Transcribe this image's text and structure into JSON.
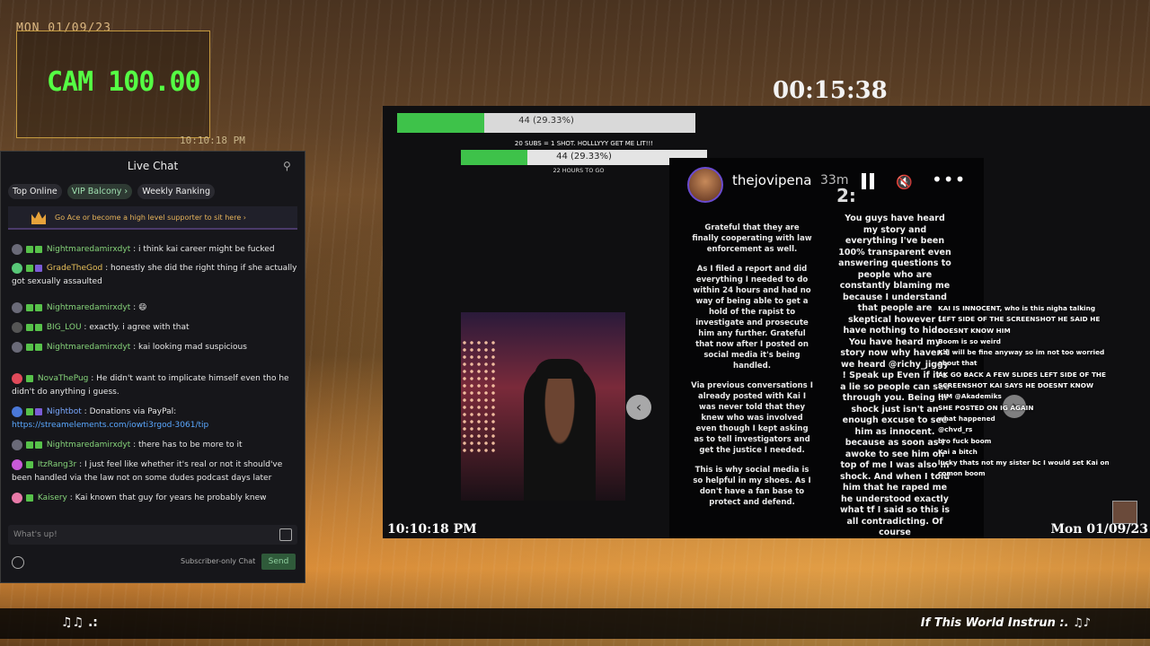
{
  "overlay": {
    "date_top": "MON 01/09/23",
    "cam_label": "CAM 100.00",
    "cam_time": "10:10:18 PM",
    "timer": "00:15:38",
    "time_left": "10:10:18 PM",
    "date_right": "Mon 01/09/23",
    "notes_left": "♫♫ .:",
    "song": "If This World Instrun :. ♫♪"
  },
  "chat": {
    "title": "Live Chat",
    "tabs": [
      "Top Online",
      "VIP Balcony ›",
      "Weekly Ranking"
    ],
    "promo": "Go Ace or become a high level supporter to sit here ›",
    "input_placeholder": "What's up!",
    "subscriber_only": "Subscriber-only Chat",
    "send": "Send",
    "messages": [
      {
        "user": "Nightmaredamirxdyt",
        "text": "i think kai career might be fucked"
      },
      {
        "user": "GradeTheGod",
        "text": "honestly she did the right thing if she actually got sexually assaulted"
      },
      {
        "user": "Nightmaredamirxdyt",
        "text": "😄"
      },
      {
        "user": "BIG_LOU",
        "text": "exactly. i agree with that"
      },
      {
        "user": "Nightmaredamirxdyt",
        "text": "kai looking mad suspicious"
      },
      {
        "user": "NovaThePug",
        "text": "He didn't want to implicate himself even tho he didn't do anything i guess."
      },
      {
        "user": "Nightbot",
        "text": "Donations via PayPal:",
        "link": "https://streamelements.com/iowti3rgod-3061/tip"
      },
      {
        "user": "Nightmaredamirxdyt",
        "text": "there has to be more to it"
      },
      {
        "user": "ItzRang3r",
        "text": "I just feel like whether it's real or not it should've been handled via the law not on some dudes podcast days later"
      },
      {
        "user": "Kaisery",
        "text": "Kai known that guy for years he probably knew"
      }
    ]
  },
  "goals": {
    "bar1_label": "44 (29.33%)",
    "bar1_progress": 0.2933,
    "sub_goal": "20 SUBS = 1 SHOT. HOLLLYYY GET ME LIT!!!",
    "bar2_label": "44 (29.33%)",
    "bar2_progress": 0.2933,
    "hours": "22 HOURS TO GO"
  },
  "story": {
    "handle": "thejovipena",
    "age": "33m",
    "page_marker": "2:",
    "col1": [
      "Grateful that they are finally cooperating with law enforcement as well.",
      "As I filed a report and did everything I needed to do within 24 hours and had no way of being able to get a hold of the rapist to investigate and prosecute him any further. Grateful that now after I posted on social media it's being handled.",
      "Via previous conversations I already posted with Kai I was never told that they knew who was involved even though I kept asking as to tell investigators and get the justice I needed.",
      "This is why social media is so helpful in my shoes. As I don't have a fan base to protect and defend."
    ],
    "col2": "You guys have heard my story and everything I've been 100% transparent even answering questions to people who are constantly blaming me because I understand that people are skeptical however I have nothing to hide. You have heard my story now why haven't we heard @richy_jiggy ! Speak up Even if it's a lie so people can see through you. Being in shock just isn't an enough excuse to see him as innocent. because as soon as I awoke to see him on top of me I was also in shock. And when I told him that he raped me he understood exactly what tf I said so this is all contradicting. Of course"
  },
  "overlay_chat": [
    "KAI IS INNOCENT, who is this nigha talking",
    "LEFT SIDE OF THE SCREENSHOT HE SAID HE",
    "DOESNT KNOW HIM",
    "Boom is so weird",
    "Kai will be fine anyway so im not too worried",
    "about that",
    "AK GO BACK A FEW SLIDES LEFT SIDE OF THE",
    "SCREENSHOT KAI SAYS HE DOESNT KNOW",
    "HIM @Akademiks",
    "SHE POSTED ON IG AGAIN",
    "what happened",
    "@chvd_rs",
    "bro fuck boom",
    "Kai a bitch",
    "lucky thats not my sister bc I would set Kai on",
    "",
    "comon boom"
  ],
  "colors": {
    "accent_green": "#3ec24a",
    "cam_green": "#55ff44",
    "link": "#5aa8ff"
  }
}
